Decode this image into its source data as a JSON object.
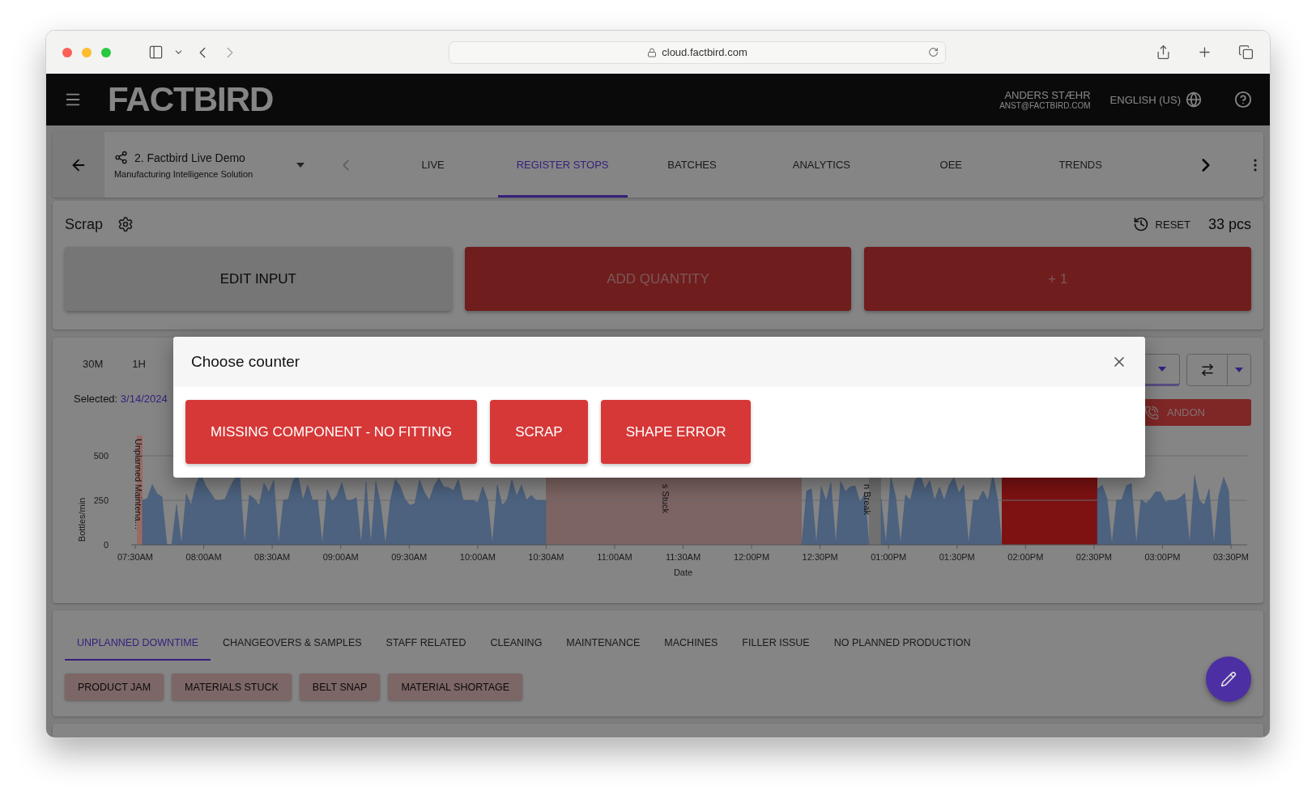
{
  "browser": {
    "url": "cloud.factbird.com"
  },
  "header": {
    "logo": "FACTBIRD",
    "user_name": "ANDERS STÆHR",
    "user_email": "ANST@FACTBIRD.COM",
    "language": "ENGLISH (US)"
  },
  "nav": {
    "line_name": "2. Factbird Live Demo",
    "line_subtitle": "Manufacturing Intelligence Solution",
    "prev_disabled": true,
    "tabs": [
      {
        "label": "LIVE",
        "selected": false
      },
      {
        "label": "REGISTER STOPS",
        "selected": true
      },
      {
        "label": "BATCHES",
        "selected": false
      },
      {
        "label": "ANALYTICS",
        "selected": false
      },
      {
        "label": "OEE",
        "selected": false
      },
      {
        "label": "TRENDS",
        "selected": false
      }
    ]
  },
  "counter": {
    "title": "Scrap",
    "reset": "RESET",
    "count": "33 pcs",
    "buttons": [
      {
        "label": "EDIT INPUT",
        "kind": "neutral"
      },
      {
        "label": "ADD QUANTITY",
        "kind": "primary"
      },
      {
        "label": "+ 1",
        "kind": "primary"
      }
    ]
  },
  "chart_panel": {
    "ranges": [
      "30M",
      "1H"
    ],
    "selected_label": "Selected:",
    "selected_value": "3/14/2024",
    "andon": "ANDON",
    "chart": {
      "ylabel": "Bottles/min",
      "xlabel": "Date",
      "yticks": [
        "500",
        "250",
        "0"
      ],
      "xticks": [
        "07:30AM",
        "08:00AM",
        "08:30AM",
        "09:00AM",
        "09:30AM",
        "10:00AM",
        "10:30AM",
        "11:00AM",
        "11:30AM",
        "12:00PM",
        "12:30PM",
        "01:00PM",
        "01:30PM",
        "02:00PM",
        "02:30PM",
        "03:00PM",
        "03:30PM"
      ],
      "stops": [
        {
          "label": "Unplanned Maintena…",
          "color": "#9a6a64"
        },
        {
          "label": "s Stuck",
          "color": "#7c6462"
        },
        {
          "label": "n Break",
          "color": "#707070"
        },
        {
          "color": "#7e1212"
        }
      ]
    }
  },
  "modal": {
    "title": "Choose counter",
    "options": [
      "MISSING COMPONENT - NO FITTING",
      "SCRAP",
      "SHAPE ERROR"
    ]
  },
  "bottom": {
    "tabs": [
      {
        "label": "UNPLANNED DOWNTIME",
        "selected": true
      },
      {
        "label": "CHANGEOVERS & SAMPLES",
        "selected": false
      },
      {
        "label": "STAFF RELATED",
        "selected": false
      },
      {
        "label": "CLEANING",
        "selected": false
      },
      {
        "label": "MAINTENANCE",
        "selected": false
      },
      {
        "label": "MACHINES",
        "selected": false
      },
      {
        "label": "FILLER ISSUE",
        "selected": false
      },
      {
        "label": "NO PLANNED PRODUCTION",
        "selected": false
      }
    ],
    "chips": [
      "PRODUCT JAM",
      "MATERIALS STUCK",
      "BELT SNAP",
      "MATERIAL SHORTAGE"
    ]
  }
}
